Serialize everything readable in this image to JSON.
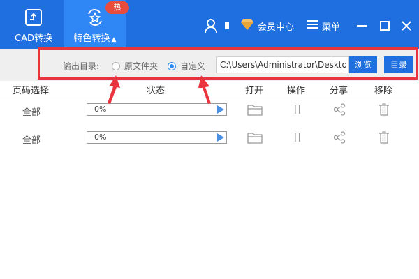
{
  "titlebar": {
    "tabs": [
      {
        "label": "CAD转换",
        "icon": "cad-convert-icon",
        "active": false
      },
      {
        "label": "特色转换",
        "icon": "feature-convert-icon",
        "active": true,
        "expand_icon": "triangle-up-icon"
      }
    ],
    "hot_badge": "热",
    "vip_label": "会员中心",
    "menu_label": "菜单"
  },
  "options": {
    "output_label": "输出目录:",
    "radio_original": "原文件夹",
    "radio_custom": "自定义",
    "selected": "custom",
    "path_value": "C:\\Users\\Administrator\\Desktop",
    "browse_label": "浏览",
    "directory_label": "目录"
  },
  "table": {
    "headers": [
      "页码选择",
      "状态",
      "打开",
      "操作",
      "分享",
      "移除"
    ],
    "rows": [
      {
        "page": "全部",
        "progress_text": "0%",
        "progress": 0
      },
      {
        "page": "全部",
        "progress_text": "0%",
        "progress": 0
      }
    ]
  },
  "colors": {
    "titlebar": "#1f6fe0",
    "active_tab": "#2f86f5",
    "badge": "#e94b3c",
    "highlight": "#e8353d",
    "button": "#1f6fe0"
  }
}
